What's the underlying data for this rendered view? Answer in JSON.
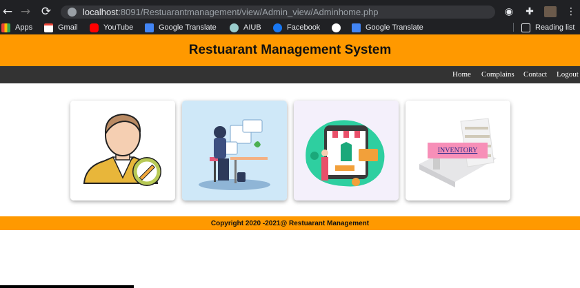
{
  "browser": {
    "url_host": "localhost",
    "url_rest": ":8091/Restuarantmanagement/view/Admin_view/Adminhome.php",
    "bookmarks": [
      {
        "label": "Apps"
      },
      {
        "label": "Gmail"
      },
      {
        "label": "YouTube"
      },
      {
        "label": "Google Translate"
      },
      {
        "label": "AIUB"
      },
      {
        "label": "Facebook"
      },
      {
        "label": ""
      },
      {
        "label": "Google Translate"
      }
    ],
    "reading_list": "Reading list"
  },
  "header": {
    "title": "Restuarant Management System"
  },
  "nav": {
    "home": "Home",
    "complains": "Complains",
    "contact": "Contact",
    "logout": "Logout"
  },
  "cards": {
    "inventory_label": "INVENTORY"
  },
  "footer": {
    "text": "Copyright 2020 -2021@ Restuarant Management"
  },
  "colors": {
    "accent": "#ff9900",
    "nav_bg": "#333333"
  }
}
